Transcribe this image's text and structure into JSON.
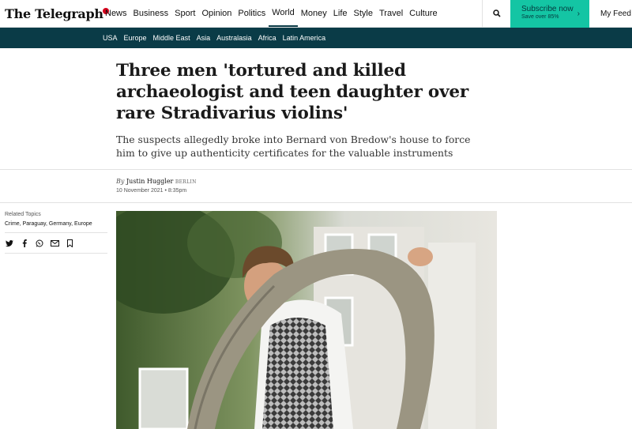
{
  "header": {
    "logo_text": "The Telegraph",
    "nav": [
      "News",
      "Business",
      "Sport",
      "Opinion",
      "Politics",
      "World",
      "Money",
      "Life",
      "Style",
      "Travel",
      "Culture"
    ],
    "active_nav": "World",
    "subscribe_label": "Subscribe now",
    "subscribe_offer": "Save over 85%",
    "my_feed_label": "My Feed",
    "brand_color": "#0a3b47",
    "accent_color": "#14c5a4"
  },
  "subnav": [
    "USA",
    "Europe",
    "Middle East",
    "Asia",
    "Australasia",
    "Africa",
    "Latin America"
  ],
  "article": {
    "headline": "Three men 'tortured and killed archaeologist and teen daughter over rare Stradivarius violins'",
    "standfirst": "The suspects allegedly broke into Bernard von Bredow's house to force him to give up authenticity certificates for the valuable instruments",
    "byline_prefix": "By",
    "author": "Justin Huggler",
    "location": "BERLIN",
    "date": "10 November 2021 • 8:35pm"
  },
  "sidebar": {
    "related_label": "Related Topics",
    "related_topics": "Crime, Paraguay, Germany, Europe",
    "share_icons": [
      "twitter-icon",
      "facebook-icon",
      "whatsapp-icon",
      "email-icon",
      "bookmark-icon"
    ]
  }
}
